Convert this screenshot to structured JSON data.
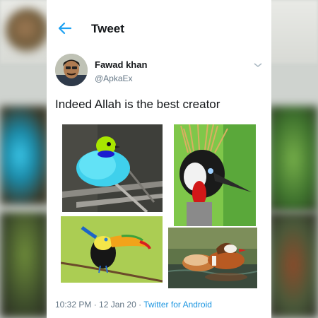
{
  "header": {
    "title": "Tweet",
    "back_icon": "arrow-left-icon",
    "accent_color": "#1da1f2"
  },
  "tweet": {
    "author_name": "Fawad khan",
    "author_handle": "@ApkaEx",
    "text": "Indeed Allah is the best creator",
    "options_icon": "chevron-down-icon",
    "time": "10:32 PM",
    "separator": " · ",
    "date": "12 Jan 20",
    "source": "Twitter for Android"
  },
  "photos": [
    {
      "subject": "turquoise-bird-with-green-head"
    },
    {
      "subject": "crowned-crane-head"
    },
    {
      "subject": "toucan-on-branch"
    },
    {
      "subject": "mandarin-ducks-on-water"
    }
  ]
}
